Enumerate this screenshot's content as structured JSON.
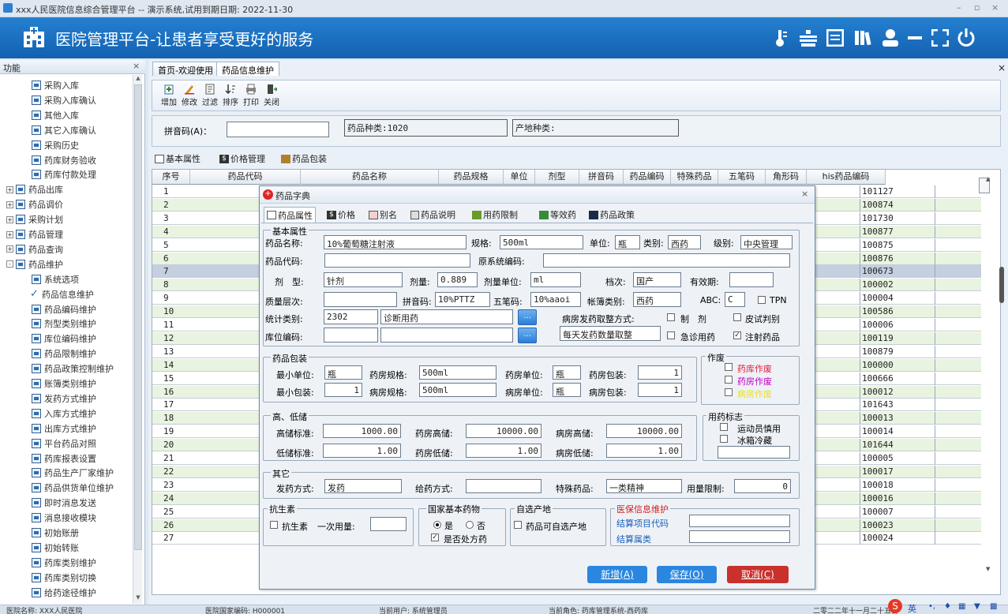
{
  "window": {
    "title": "xxx人民医院信息综合管理平台 -- 演示系统,试用到期日期: 2022-11-30"
  },
  "banner": {
    "title": "医院管理平台-让患者享受更好的服务"
  },
  "left_panel": {
    "header": "功能",
    "items": [
      {
        "label": "采购入库",
        "level": 2
      },
      {
        "label": "采购入库确认",
        "level": 2
      },
      {
        "label": "其他入库",
        "level": 2
      },
      {
        "label": "其它入库确认",
        "level": 2
      },
      {
        "label": "采购历史",
        "level": 2
      },
      {
        "label": "药库财务验收",
        "level": 2
      },
      {
        "label": "药库付款处理",
        "level": 2
      },
      {
        "label": "药品出库",
        "level": 1,
        "expander": "+"
      },
      {
        "label": "药品调价",
        "level": 1,
        "expander": "+"
      },
      {
        "label": "采购计划",
        "level": 1,
        "expander": "+"
      },
      {
        "label": "药品管理",
        "level": 1,
        "expander": "+"
      },
      {
        "label": "药品查询",
        "level": 1,
        "expander": "+"
      },
      {
        "label": "药品维护",
        "level": 1,
        "expander": "-"
      },
      {
        "label": "系统选项",
        "level": 2
      },
      {
        "label": "药品信息维护",
        "level": 2,
        "checked": true
      },
      {
        "label": "药品编码维护",
        "level": 2
      },
      {
        "label": "剂型类别维护",
        "level": 2
      },
      {
        "label": "库位编码维护",
        "level": 2
      },
      {
        "label": "药品限制维护",
        "level": 2
      },
      {
        "label": "药品政策控制维护",
        "level": 2
      },
      {
        "label": "账簿类别维护",
        "level": 2
      },
      {
        "label": "发药方式维护",
        "level": 2
      },
      {
        "label": "入库方式维护",
        "level": 2
      },
      {
        "label": "出库方式维护",
        "level": 2
      },
      {
        "label": "平台药品对照",
        "level": 2
      },
      {
        "label": "药库报表设置",
        "level": 2
      },
      {
        "label": "药品生产厂家维护",
        "level": 2
      },
      {
        "label": "药品供货单位维护",
        "level": 2
      },
      {
        "label": "即时消息发送",
        "level": 2
      },
      {
        "label": "消息接收模块",
        "level": 2
      },
      {
        "label": "初始账册",
        "level": 2
      },
      {
        "label": "初始转账",
        "level": 2
      },
      {
        "label": "药库类别维护",
        "level": 2
      },
      {
        "label": "药库类别切换",
        "level": 2
      },
      {
        "label": "给药途径维护",
        "level": 2
      }
    ]
  },
  "tabs": [
    {
      "label": "首页-欢迎使用"
    },
    {
      "label": "药品信息维护"
    }
  ],
  "toolbar": {
    "add": "增加",
    "edit": "修改",
    "filter": "过滤",
    "sort": "排序",
    "print": "打印",
    "close": "关闭"
  },
  "search": {
    "pinyin_label": "拼音码(A)：",
    "pinyin_value": "",
    "drug_kinds": "药品种类:1020",
    "origin_kinds": "产地种类:"
  },
  "subtabs": {
    "basic": "基本属性",
    "price": "价格管理",
    "pack": "药品包装"
  },
  "grid": {
    "headers": [
      "序号",
      "药品代码",
      "药品名称",
      "药品规格",
      "单位",
      "剂型",
      "拼音码",
      "药品编码",
      "特殊药品",
      "五笔码",
      "角形码",
      "his药品编码"
    ],
    "rows": [
      {
        "n": "1",
        "his": "101127"
      },
      {
        "n": "2",
        "his": "100874"
      },
      {
        "n": "3",
        "his": "101730"
      },
      {
        "n": "4",
        "his": "100877"
      },
      {
        "n": "5",
        "his": "100875"
      },
      {
        "n": "6",
        "his": "100876"
      },
      {
        "n": "7",
        "his": "100673"
      },
      {
        "n": "8",
        "his": "100002"
      },
      {
        "n": "9",
        "his": "100004"
      },
      {
        "n": "10",
        "his": "100586"
      },
      {
        "n": "11",
        "his": "100006"
      },
      {
        "n": "12",
        "his": "100119"
      },
      {
        "n": "13",
        "his": "100879"
      },
      {
        "n": "14",
        "his": "100000"
      },
      {
        "n": "15",
        "his": "100666"
      },
      {
        "n": "16",
        "his": "100012"
      },
      {
        "n": "17",
        "his": "101643"
      },
      {
        "n": "18",
        "his": "100013"
      },
      {
        "n": "19",
        "his": "100014"
      },
      {
        "n": "20",
        "his": "101644"
      },
      {
        "n": "21",
        "his": "100005"
      },
      {
        "n": "22",
        "his": "100017"
      },
      {
        "n": "23",
        "his": "100018"
      },
      {
        "n": "24",
        "his": "100016"
      },
      {
        "n": "25",
        "his": "100007"
      },
      {
        "n": "26",
        "his": "100023"
      },
      {
        "n": "27",
        "his": "100024"
      }
    ]
  },
  "dialog": {
    "title": "药品字典",
    "tabs": [
      "药品属性",
      "价格",
      "别名",
      "药品说明",
      "用药限制",
      "等效药",
      "药品政策"
    ],
    "basic": {
      "group": "基本属性",
      "name_l": "药品名称:",
      "name_v": "10%葡萄糖注射液",
      "spec_l": "规格:",
      "spec_v": "500ml",
      "unit_l": "单位:",
      "unit_v": "瓶",
      "cat_l": "类别:",
      "cat_v": "西药",
      "level_l": "级别:",
      "level_v": "中央管理",
      "code_l": "药品代码:",
      "code_v": "",
      "orig_l": "原系统编码:",
      "orig_v": "",
      "form_l": "剂　型:",
      "form_v": "针剂",
      "dose_l": "剂量:",
      "dose_v": "0.889",
      "doseu_l": "剂量单位:",
      "doseu_v": "ml",
      "grade_l": "档次:",
      "grade_v": "国产",
      "valid_l": "有效期:",
      "valid_v": "",
      "quality_l": "质量层次:",
      "quality_v": "",
      "py_l": "拼音码:",
      "py_v": "10%PTTZ",
      "wb_l": "五笔码:",
      "wb_v": "10%aaoi",
      "book_l": "帐簿类别:",
      "book_v": "西药",
      "abc_l": "ABC:",
      "abc_v": "C",
      "tpn": "TPN",
      "stat_l": "统计类别:",
      "stat_v": "2302",
      "stat_name": "诊断用药",
      "ward_l": "病房发药取整方式:",
      "zhiji": "制　剂",
      "skin": "皮试判别",
      "loc_l": "库位编码:",
      "loc_v": "",
      "round_v": "每天发药数量取整",
      "emerg": "急诊用药",
      "inject": "注射药品"
    },
    "pack": {
      "group": "药品包装",
      "min_unit_l": "最小单位:",
      "min_unit_v": "瓶",
      "ph_spec_l": "药房规格:",
      "ph_spec_v": "500ml",
      "ph_unit_l": "药房单位:",
      "ph_unit_v": "瓶",
      "ph_pack_l": "药房包装:",
      "ph_pack_v": "1",
      "min_pack_l": "最小包装:",
      "min_pack_v": "1",
      "wd_spec_l": "病房规格:",
      "wd_spec_v": "500ml",
      "wd_unit_l": "病房单位:",
      "wd_unit_v": "瓶",
      "wd_pack_l": "病房包装:",
      "wd_pack_v": "1"
    },
    "void": {
      "group": "作废",
      "a": "药库作废",
      "b": "药房作废",
      "c": "病房作废"
    },
    "stock": {
      "group": "高、低储",
      "high_l": "高储标准:",
      "high_v": "1000.00",
      "ph_high_l": "药房高储:",
      "ph_high_v": "10000.00",
      "wd_high_l": "病房高储:",
      "wd_high_v": "10000.00",
      "low_l": "低储标准:",
      "low_v": "1.00",
      "ph_low_l": "药房低储:",
      "ph_low_v": "1.00",
      "wd_low_l": "病房低储:",
      "wd_low_v": "1.00"
    },
    "usage": {
      "group": "用药标志",
      "athlete": "运动员慎用",
      "fridge": "冰箱冷藏"
    },
    "other": {
      "group": "其它",
      "dispense_l": "发药方式:",
      "dispense_v": "发药",
      "route_l": "给药方式:",
      "route_v": "",
      "special_l": "特殊药品:",
      "special_v": "一类精神",
      "limit_l": "用量限制:",
      "limit_v": "0"
    },
    "anti": {
      "group": "抗生素",
      "label": "抗生素",
      "once_l": "一次用量:"
    },
    "national": {
      "group": "国家基本药物",
      "yes": "是",
      "no": "否",
      "rx": "是否处方药"
    },
    "origin": {
      "group": "自选产地",
      "label": "药品可自选产地"
    },
    "insurance": {
      "group": "医保信息维护",
      "code": "结算项目代码",
      "attr": "结算属类"
    },
    "buttons": {
      "new": "新增(A)",
      "save": "保存(O)",
      "cancel": "取消(C)"
    }
  },
  "status": {
    "hospital": "医院名称: XXX人民医院",
    "national_code": "医院国家编码: H000001",
    "user": "当前用户: 系统管理员",
    "role": "当前角色: 药库管理系统-西药库",
    "date": "二零二二年十一月二十五日",
    "ime": "英"
  },
  "colors": {
    "banner": "#1a6dc0",
    "void_red": "#e0203f",
    "void_magenta": "#c000c0",
    "void_yellow": "#e8e020",
    "insurance_red": "#d02020",
    "btn_blue": "#2a86df",
    "btn_red": "#c8312c"
  }
}
